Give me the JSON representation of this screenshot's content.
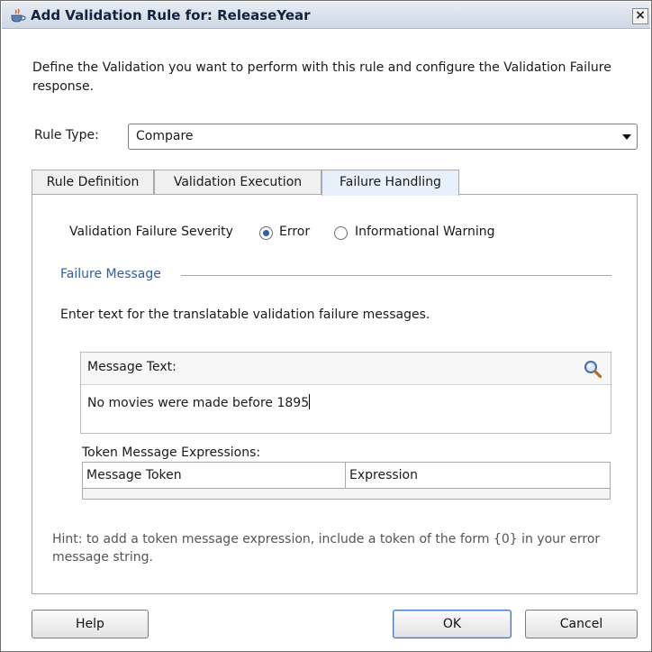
{
  "window": {
    "title": "Add Validation Rule for: ReleaseYear",
    "close_glyph": "×",
    "icon": "java-cup-icon"
  },
  "intro_text": "Define the Validation you want to perform with this rule and configure the Validation Failure response.",
  "rule_type": {
    "label": "Rule Type:",
    "value": "Compare"
  },
  "tabs": [
    {
      "label": "Rule Definition",
      "active": false
    },
    {
      "label": "Validation Execution",
      "active": false
    },
    {
      "label": "Failure Handling",
      "active": true
    }
  ],
  "severity": {
    "label": "Validation Failure Severity",
    "options": [
      {
        "label": "Error",
        "selected": true
      },
      {
        "label": "Informational Warning",
        "selected": false
      }
    ]
  },
  "failure_message": {
    "section_title": "Failure Message",
    "instructions": "Enter text for the translatable validation failure messages.",
    "message_text_label": "Message Text:",
    "message_text_value": "No movies were made before 1895"
  },
  "token_expressions": {
    "label": "Token Message Expressions:",
    "columns": [
      "Message Token",
      "Expression"
    ]
  },
  "hint": "Hint: to add a token message expression, include a token of the form {0} in your error message string.",
  "buttons": {
    "help": "Help",
    "ok": "OK",
    "cancel": "Cancel"
  },
  "colors": {
    "section_title": "#2b5ea8",
    "active_tab": "#e7f0fb",
    "radio_dot": "#2f5fa8"
  }
}
